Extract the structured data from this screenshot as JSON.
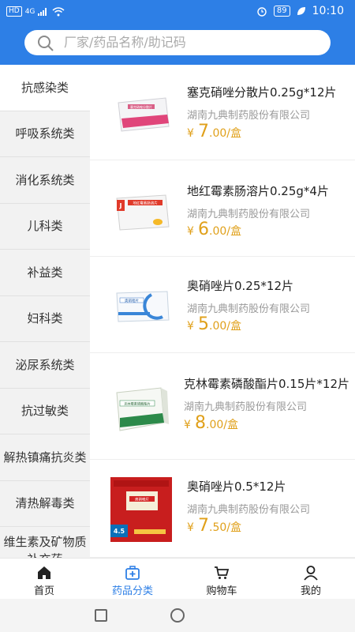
{
  "statusbar": {
    "network_badge": "HD",
    "signal_label": "4G",
    "battery": "89",
    "time": "10:10"
  },
  "search": {
    "placeholder": "厂家/药品名称/助记码"
  },
  "categories": [
    "抗感染类",
    "呼吸系统类",
    "消化系统类",
    "儿科类",
    "补益类",
    "妇科类",
    "泌尿系统类",
    "抗过敏类",
    "解热镇痛抗炎类",
    "清热解毒类",
    "维生素及矿物质补充药"
  ],
  "active_category": "抗感染类",
  "products": [
    {
      "name": "塞克硝唑分散片0.25g*12片",
      "maker": "湖南九典制药股份有限公司",
      "currency": "¥",
      "price_int": "7",
      "price_dec": ".00/盒",
      "box_label": "塞克硝唑分散片"
    },
    {
      "name": "地红霉素肠溶片0.25g*4片",
      "maker": "湖南九典制药股份有限公司",
      "currency": "¥",
      "price_int": "6",
      "price_dec": ".00/盒",
      "box_label": "地红霉素肠溶片"
    },
    {
      "name": "奥硝唑片0.25*12片",
      "maker": "湖南九典制药股份有限公司",
      "currency": "¥",
      "price_int": "5",
      "price_dec": ".00/盒",
      "box_label": "奥硝唑片"
    },
    {
      "name": "克林霉素磷酸酯片0.15片*12片",
      "maker": "湖南九典制药股份有限公司",
      "currency": "¥",
      "price_int": "8",
      "price_dec": ".00/盒",
      "box_label": "克林霉素磷酸酯片"
    },
    {
      "name": "奥硝唑片0.5*12片",
      "maker": "湖南九典制药股份有限公司",
      "currency": "¥",
      "price_int": "7",
      "price_dec": ".50/盒",
      "box_label": "奥硝唑片",
      "promo_value": "4.5"
    }
  ],
  "tabs": [
    {
      "label": "首页",
      "icon": "home-icon"
    },
    {
      "label": "药品分类",
      "icon": "medicine-box-icon"
    },
    {
      "label": "购物车",
      "icon": "cart-icon"
    },
    {
      "label": "我的",
      "icon": "user-icon"
    }
  ],
  "colors": {
    "brand": "#2d7fe6",
    "price": "#e0a01a",
    "sidebar_bg": "#f2f2f2"
  }
}
